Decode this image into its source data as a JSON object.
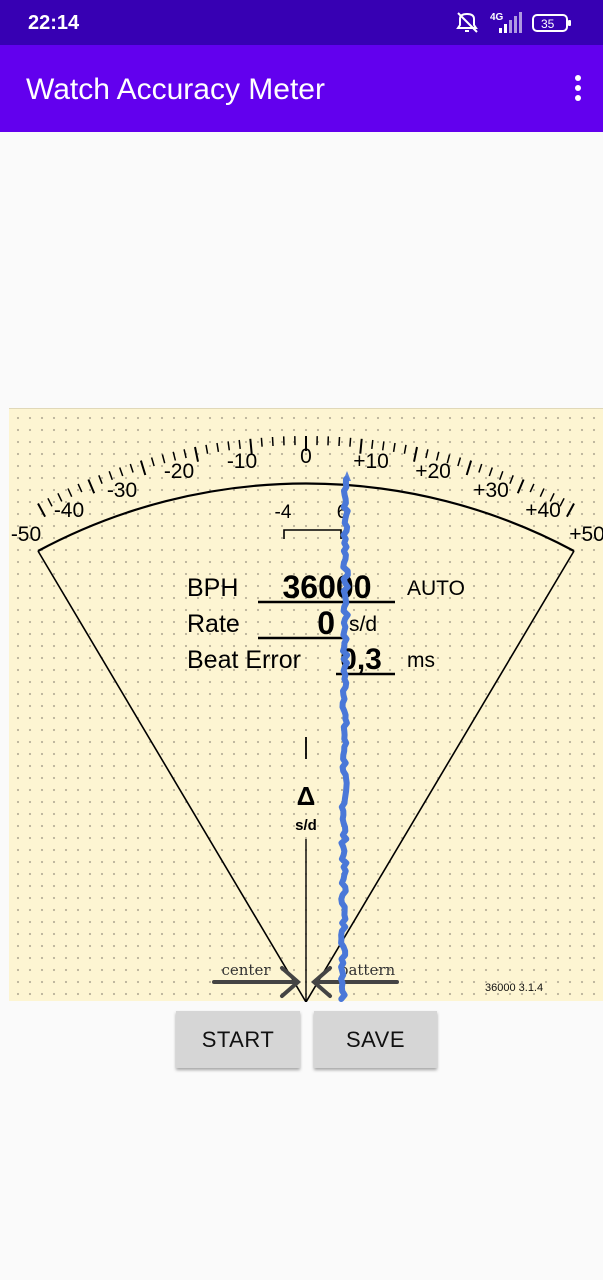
{
  "status_bar": {
    "time": "22:14",
    "network": "4G",
    "battery": "35",
    "icons": [
      "mute-vibrate-icon",
      "signal-icon",
      "battery-icon"
    ]
  },
  "app_bar": {
    "title": "Watch Accuracy Meter",
    "overflow_icon": "more-vert-icon"
  },
  "meter": {
    "scale_labels": [
      "-50",
      "-40",
      "-30",
      "-20",
      "-10",
      "0",
      "+10",
      "+20",
      "+30",
      "+40",
      "+50"
    ],
    "inner_label_left": "-4",
    "inner_label_right": "6",
    "bph_label": "BPH",
    "bph_value": "36000",
    "bph_mode": "AUTO",
    "rate_label": "Rate",
    "rate_value": "0",
    "rate_unit": "s/d",
    "beat_error_label": "Beat Error",
    "beat_error_value": "0,3",
    "beat_error_unit": "ms",
    "delta_symbol": "Δ",
    "delta_unit": "s/d",
    "center_label": "center",
    "pattern_label": "pattern",
    "version": "36000 3.1.4",
    "trace_color": "#4a78d8"
  },
  "buttons": {
    "start": "START",
    "save": "SAVE"
  }
}
